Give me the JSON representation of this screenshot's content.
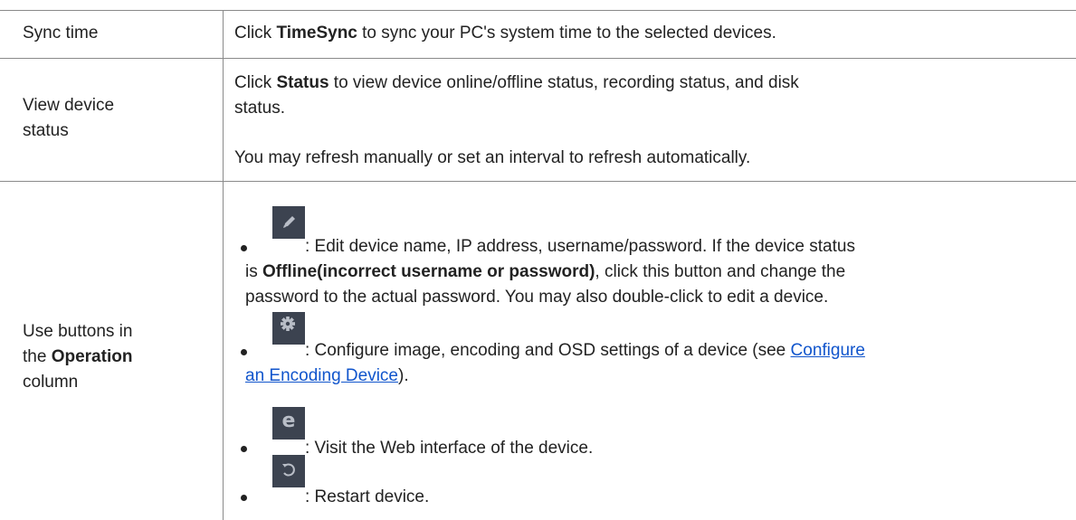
{
  "rows": [
    {
      "label": "Sync time",
      "desc": {
        "pre": "Click ",
        "bold": "TimeSync",
        "post": " to sync your PC's system time to the selected devices."
      }
    },
    {
      "label_line1": "View device",
      "label_line2": "status",
      "desc1": {
        "pre": "Click ",
        "bold": "Status",
        "post_line1": " to view device online/offline status, recording status, and disk",
        "post_line2": "status."
      },
      "desc2": "You may refresh manually or set an interval to refresh automatically."
    },
    {
      "label_line1": "Use buttons in",
      "label_line2_pre": "the ",
      "label_line2_bold": "Operation",
      "label_line3": "column",
      "items": [
        {
          "icon": "pencil-icon",
          "line1": ": Edit device name, IP address, username/password. If the device status",
          "line2_pre": "is ",
          "line2_bold": "Offline(incorrect username or password)",
          "line2_post": ", click this button and change the",
          "line3": "password to the actual password. You may also double-click to edit a device."
        },
        {
          "icon": "gear-icon",
          "line1_pre": ": Configure image, encoding and OSD settings of a device (see ",
          "link_part1": "Configure",
          "link_part2": "an Encoding Device",
          "line2_post": ")."
        },
        {
          "icon": "web-e-icon",
          "text": ": Visit the Web interface of the device."
        },
        {
          "icon": "restart-icon",
          "text": ": Restart device."
        }
      ]
    }
  ],
  "colors": {
    "icon_bg": "#3c4350",
    "link": "#1155cc",
    "border": "#8a8a8a"
  }
}
